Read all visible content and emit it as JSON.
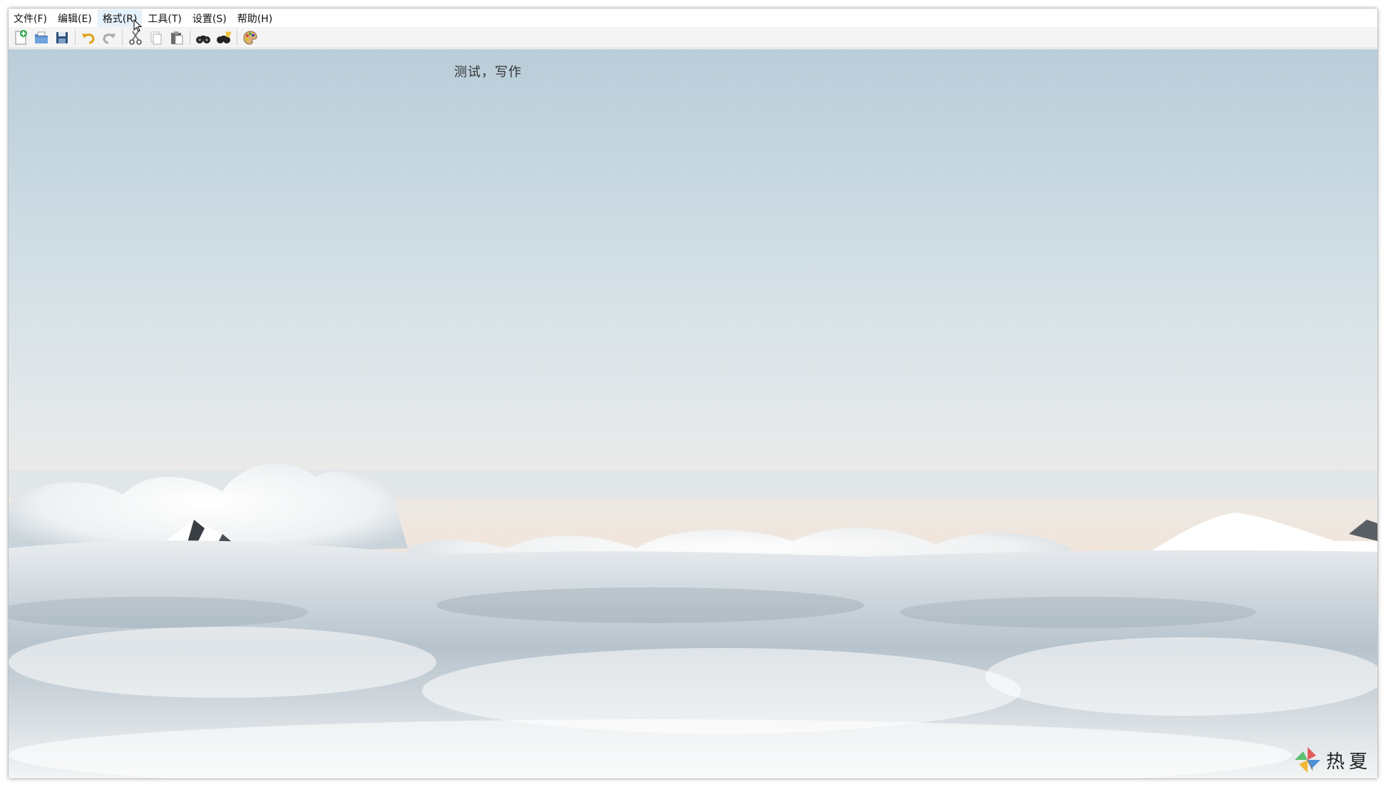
{
  "menubar": {
    "items": [
      {
        "label": "文件(F)"
      },
      {
        "label": "编辑(E)"
      },
      {
        "label": "格式(R)"
      },
      {
        "label": "工具(T)"
      },
      {
        "label": "设置(S)"
      },
      {
        "label": "帮助(H)"
      }
    ],
    "active_index": 2
  },
  "toolbar": {
    "buttons": [
      {
        "icon": "new-file-icon"
      },
      {
        "icon": "open-folder-icon"
      },
      {
        "icon": "save-icon"
      },
      {
        "icon": "undo-icon"
      },
      {
        "icon": "redo-icon"
      },
      {
        "icon": "cut-icon"
      },
      {
        "icon": "copy-icon"
      },
      {
        "icon": "paste-icon"
      },
      {
        "icon": "find-icon"
      },
      {
        "icon": "replace-icon"
      },
      {
        "icon": "palette-icon"
      }
    ]
  },
  "editor": {
    "text": "测试，写作"
  },
  "watermark": {
    "text": "热夏"
  },
  "colors": {
    "menu_active_bg": "#e5f1fb",
    "toolbar_bg": "#f4f4f4",
    "sky_top": "#b9cdd9",
    "sky_horizon": "#f3e3d8"
  }
}
